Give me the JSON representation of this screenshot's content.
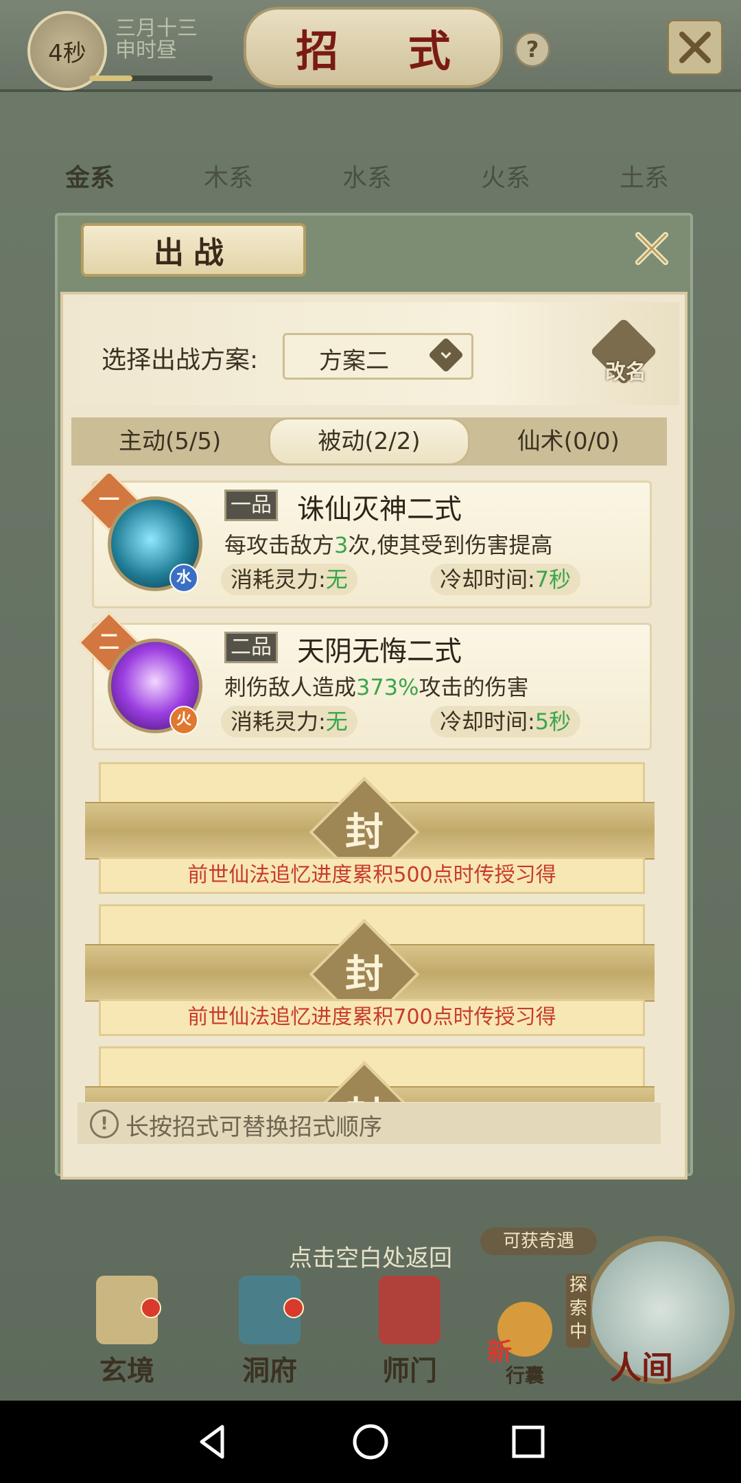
{
  "header": {
    "timer": "4秒",
    "date_line1": "三月十三",
    "date_line2": "申时昼",
    "time_progress": 0.35,
    "title": "招 式",
    "help_label": "?"
  },
  "element_tabs": [
    {
      "label": "金系",
      "active": true
    },
    {
      "label": "木系",
      "active": false
    },
    {
      "label": "水系",
      "active": false
    },
    {
      "label": "火系",
      "active": false
    },
    {
      "label": "土系",
      "active": false
    }
  ],
  "dialog": {
    "title": "出战",
    "scheme_label": "选择出战方案:",
    "scheme_value": "方案二",
    "rename_label": "改名",
    "skill_tabs": [
      {
        "label": "主动(5/5)",
        "active": false
      },
      {
        "label": "被动(2/2)",
        "active": true
      },
      {
        "label": "仙术(0/0)",
        "active": false
      }
    ],
    "skills": [
      {
        "rank": "一",
        "grade": "一品",
        "name": "诛仙灭神二式",
        "desc_pre": "每攻击敌方",
        "desc_num": "3",
        "desc_post": "次,使其受到伤害提高",
        "element": "水",
        "element_color": "#3b6fc4",
        "cost_label": "消耗灵力:",
        "cost_value": "无",
        "cd_label": "冷却时间:",
        "cd_value": "7秒"
      },
      {
        "rank": "二",
        "grade": "二品",
        "name": "天阴无悔二式",
        "desc_pre": "刺伤敌人造成",
        "desc_num": "373%",
        "desc_post": "攻击的伤害",
        "element": "火",
        "element_color": "#e0782f",
        "cost_label": "消耗灵力:",
        "cost_value": "无",
        "cd_label": "冷却时间:",
        "cd_value": "5秒"
      }
    ],
    "sealed_slots": [
      {
        "seal": "封",
        "note": "前世仙法追忆进度累积500点时传授习得"
      },
      {
        "seal": "封",
        "note": "前世仙法追忆进度累积700点时传授习得"
      },
      {
        "seal": "封",
        "note": ""
      }
    ],
    "hint": "长按招式可替换招式顺序"
  },
  "bottom": {
    "return_text": "点击空白处返回",
    "encounter_badge": "可获奇遇",
    "explore_badge": "探索中",
    "nav": [
      {
        "label": "玄境"
      },
      {
        "label": "洞府"
      },
      {
        "label": "师门"
      },
      {
        "label": "行囊"
      },
      {
        "label": "人间"
      }
    ],
    "bag_new": "新"
  },
  "android_nav": [
    "back",
    "home",
    "recents"
  ]
}
